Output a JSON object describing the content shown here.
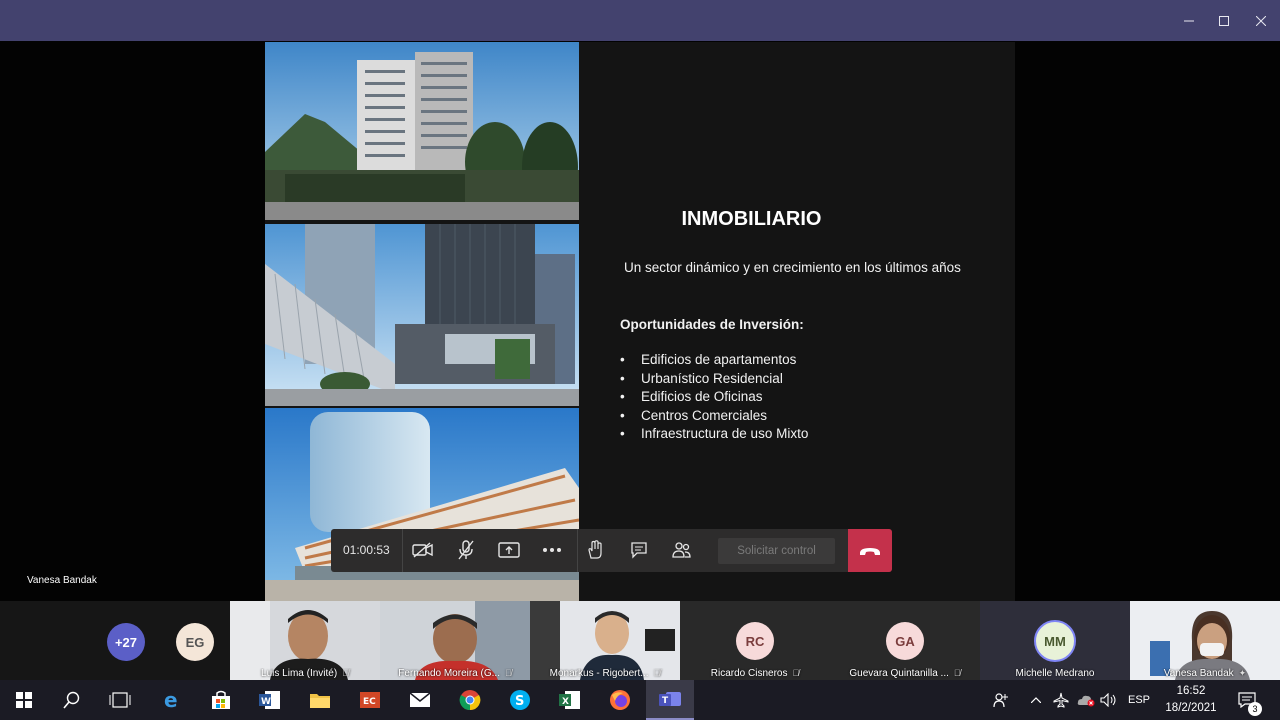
{
  "window": {
    "minimize_icon": "minimize-icon",
    "maximize_icon": "maximize-icon",
    "close_icon": "close-icon"
  },
  "slide": {
    "title": "INMOBILIARIO",
    "subtitle": "Un sector dinámico y en crecimiento en los últimos años",
    "section_heading": "Oportunidades de Inversión:",
    "bullets": [
      "Edificios de apartamentos",
      "Urbanístico Residencial",
      "Edificios de Oficinas",
      "Centros Comerciales",
      "Infraestructura de uso Mixto"
    ]
  },
  "presenter_label": "Vanesa Bandak",
  "call_controls": {
    "timer": "01:00:53",
    "request_control": "Solicitar control",
    "icons": [
      "camera-off-icon",
      "mic-off-icon",
      "share-screen-icon",
      "more-icon",
      "raise-hand-icon",
      "chat-icon",
      "participants-icon",
      "hang-up-icon"
    ]
  },
  "participants": {
    "overflow_count": "+27",
    "tiles": [
      {
        "initials": "EG",
        "name": ""
      },
      {
        "name": "Luis Lima (Invité)",
        "video": true
      },
      {
        "name": "Fernando Moreira (G...",
        "video": true
      },
      {
        "name": "Monarkus - Rigobert...",
        "video": true
      },
      {
        "initials": "RC",
        "name": "Ricardo Cisneros"
      },
      {
        "initials": "GA",
        "name": "Guevara Quintanilla ..."
      },
      {
        "initials": "MM",
        "name": "Michelle Medrano"
      },
      {
        "name": "Vanesa Bandak",
        "video": true
      }
    ]
  },
  "taskbar": {
    "apps": [
      "windows-start-icon",
      "search-icon",
      "task-view-icon",
      "edge-icon",
      "store-icon",
      "word-icon",
      "file-explorer-icon",
      "teams-ec-icon",
      "mail-icon",
      "chrome-icon",
      "skype-icon",
      "excel-icon",
      "firefox-icon",
      "teams-icon"
    ],
    "language": "ESP",
    "time": "16:52",
    "date": "18/2/2021",
    "notification_count": "3"
  },
  "colors": {
    "titlebar": "#43426e",
    "hangup": "#c4314b",
    "taskbar": "#1b1b24"
  }
}
